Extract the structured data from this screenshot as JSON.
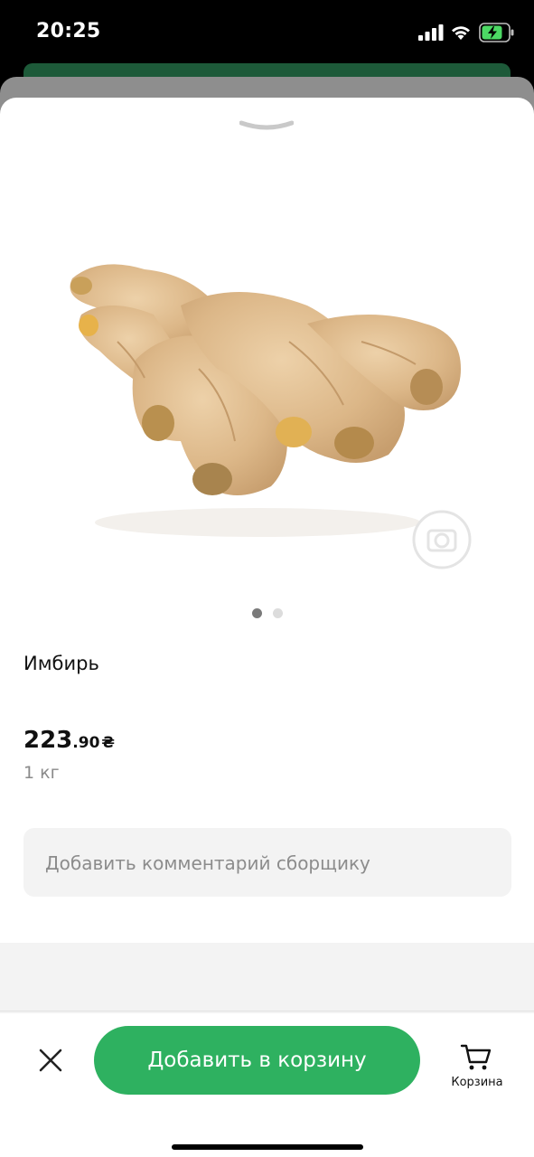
{
  "status_bar": {
    "time": "20:25"
  },
  "product": {
    "name": "Имбирь",
    "price_main": "223",
    "price_cents": ".90",
    "currency": "₴",
    "unit": "1 кг"
  },
  "carousel": {
    "total_pages": 2,
    "active_page": 1
  },
  "comment": {
    "placeholder": "Добавить комментарий сборщику"
  },
  "actions": {
    "add_to_cart_label": "Добавить в корзину",
    "cart_label": "Корзина"
  },
  "colors": {
    "accent_green": "#2eb160",
    "dark_green": "#1d5a39",
    "battery_green": "#4cd964"
  },
  "icons": [
    "signal-icon",
    "wifi-icon",
    "battery-icon",
    "chevron-down-icon",
    "camera-watermark-icon",
    "close-icon",
    "cart-icon"
  ]
}
